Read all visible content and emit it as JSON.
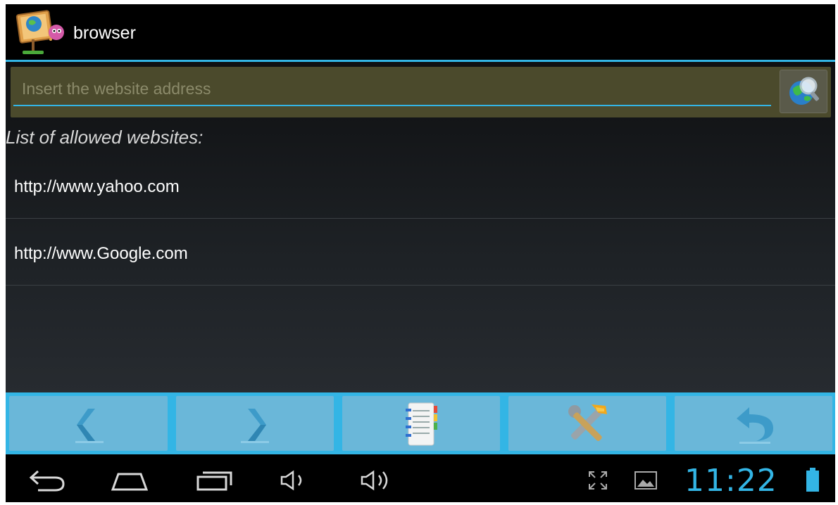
{
  "app": {
    "title": "browser"
  },
  "url_bar": {
    "placeholder": "Insert the website address",
    "value": ""
  },
  "list": {
    "header": "List of allowed websites:",
    "items": [
      "http://www.yahoo.com",
      "http://www.Google.com"
    ]
  },
  "toolbar": {
    "buttons": [
      "back-arrow-icon",
      "forward-arrow-icon",
      "notebook-icon",
      "tools-icon",
      "undo-icon"
    ]
  },
  "system_bar": {
    "clock": "11:22",
    "icons": [
      "back-icon",
      "home-icon",
      "recent-apps-icon",
      "volume-down-icon",
      "volume-up-icon",
      "fullscreen-icon",
      "gallery-icon",
      "battery-icon"
    ]
  },
  "colors": {
    "accent": "#33b5e5",
    "url_bar_bg": "#4b4a2c",
    "toolbar_button": "#6ab7d9",
    "background": "#000000"
  }
}
